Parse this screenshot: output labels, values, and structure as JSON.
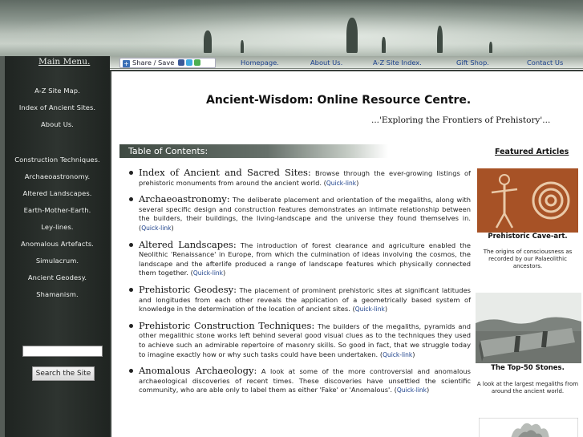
{
  "banner": {
    "alt": "standing stones in mist"
  },
  "sidebar": {
    "main_menu": "Main Menu.",
    "items": [
      {
        "label": "A-Z Site Map."
      },
      {
        "label": "Index of Ancient Sites."
      },
      {
        "label": "About Us."
      },
      {
        "label": "Construction Techniques."
      },
      {
        "label": "Archaeoastronomy."
      },
      {
        "label": "Altered Landscapes."
      },
      {
        "label": "Earth-Mother-Earth."
      },
      {
        "label": "Ley-lines."
      },
      {
        "label": "Anomalous Artefacts."
      },
      {
        "label": "Simulacrum."
      },
      {
        "label": "Ancient Geodesy."
      },
      {
        "label": "Shamanism."
      }
    ],
    "search_value": "",
    "search_button": "Search the Site"
  },
  "topnav": {
    "share": "Share / Save",
    "links": [
      {
        "label": "Homepage."
      },
      {
        "label": "About Us."
      },
      {
        "label": "A-Z Site Index."
      },
      {
        "label": "Gift Shop."
      },
      {
        "label": "Contact Us"
      }
    ]
  },
  "main": {
    "title": "Ancient-Wisdom: Online Resource Centre.",
    "tagline": "...'Exploring the Frontiers of Prehistory'...",
    "toc_header": "Table of Contents:",
    "quick_link": "Quick-link",
    "entries": [
      {
        "title": "Index of Ancient and Sacred Sites:",
        "text": " Browse through the ever-growing listings of prehistoric monuments from around the ancient world."
      },
      {
        "title": "Archaeoastronomy:",
        "text": " The deliberate placement and orientation of the megaliths, along with several specific design and construction features demonstrates an intimate relationship between the builders, their buildings, the living-landscape and the universe they found themselves in."
      },
      {
        "title": "Altered Landscapes:",
        "text": " The introduction of forest clearance and agriculture enabled the Neolithic 'Renaissance' in Europe, from which the culmination of ideas involving the cosmos, the landscape and the afterlife produced a range of landscape features which physically connected them together."
      },
      {
        "title": "Prehistoric Geodesy:",
        "text": " The placement of prominent prehistoric sites at significant latitudes and longitudes from each other reveals the application of a geometrically based system of knowledge in the determination of the location of ancient sites."
      },
      {
        "title": "Prehistoric Construction Techniques:",
        "text": " The builders of the megaliths, pyramids and other megalithic stone works left behind several good visual clues as to the techniques they used to achieve such an admirable repertoire of masonry skills. So good in fact, that we struggle today to imagine exactly how or why such tasks could have been undertaken."
      },
      {
        "title": "Anomalous Archaeology:",
        "text": " A look at some of the more controversial and anomalous archaeological discoveries of recent times. These discoveries have unsettled the scientific community, who are able only to label them as either 'Fake' or 'Anomalous'."
      }
    ]
  },
  "featured": {
    "title": "Featured Articles",
    "items": [
      {
        "caption": "Prehistoric Cave-art.",
        "desc": "The origins of consciousness as recorded by our Palaeolithic ancestors."
      },
      {
        "caption": "The Top-50 Stones.",
        "desc": "A look at the largest megaliths from around the ancient world."
      }
    ]
  }
}
